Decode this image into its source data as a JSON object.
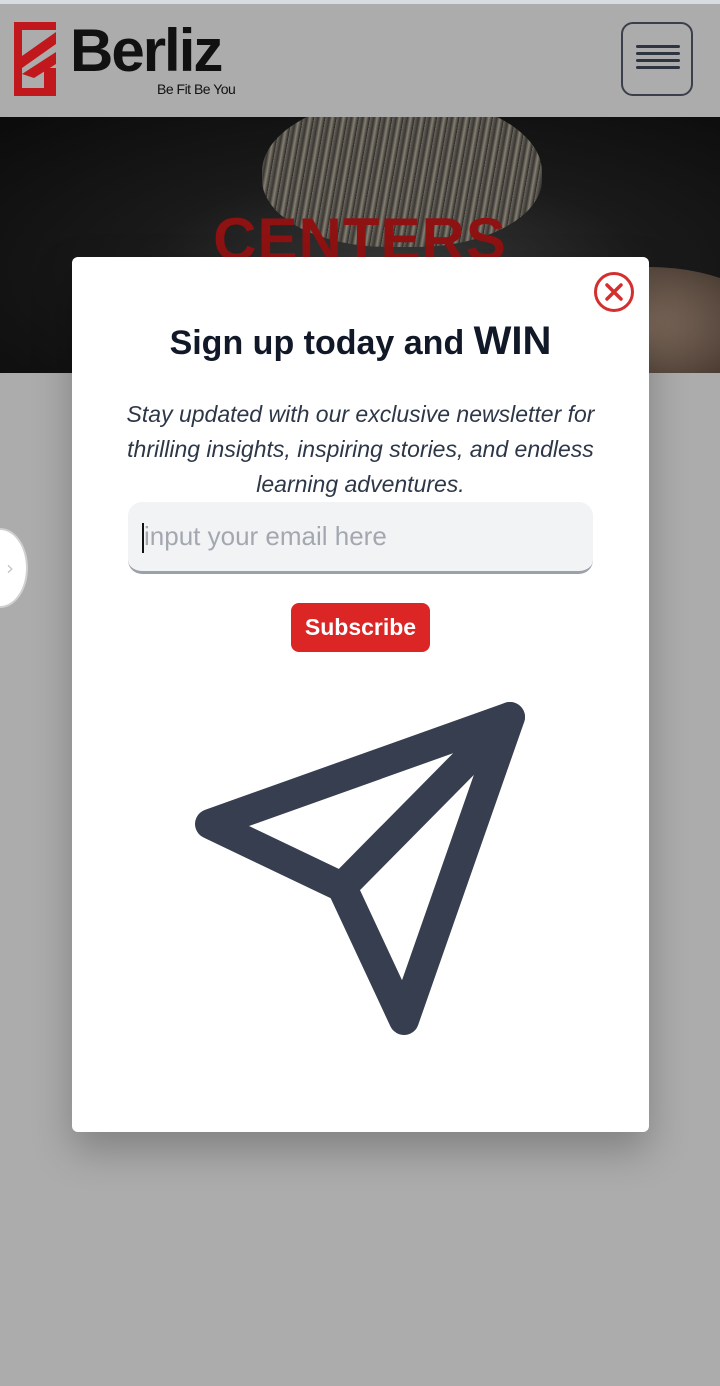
{
  "brand": {
    "name": "Berliz",
    "tagline": "Be Fit Be You",
    "accent_color": "#c0181c"
  },
  "header": {
    "menu_icon": "hamburger-icon"
  },
  "hero": {
    "title": "CENTERS"
  },
  "modal": {
    "heading_prefix": "Sign up today and ",
    "heading_emphasis": "WIN",
    "description": "Stay updated with our exclusive newsletter for thrilling insights, inspiring stories, and endless learning adventures.",
    "email_placeholder": "input your email here",
    "email_value": "",
    "subscribe_label": "Subscribe",
    "subscribe_color": "#dc2626",
    "close_icon": "close-circle-icon",
    "illustration_icon": "send-icon"
  },
  "side_handle_icon": "chevron-right-icon"
}
